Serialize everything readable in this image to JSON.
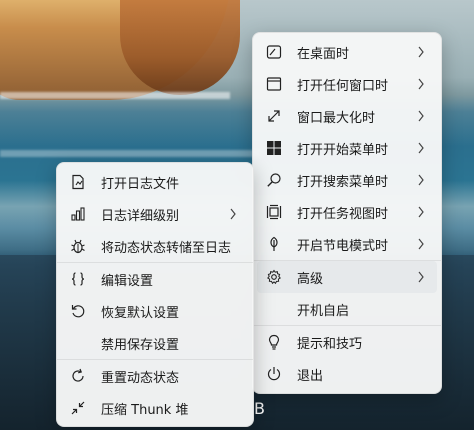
{
  "right_menu": {
    "items": [
      {
        "label": "在桌面时",
        "icon": "desktop-icon",
        "submenu": true
      },
      {
        "label": "打开任何窗口时",
        "icon": "window-icon",
        "submenu": true
      },
      {
        "label": "窗口最大化时",
        "icon": "maximize-icon",
        "submenu": true
      },
      {
        "label": "打开开始菜单时",
        "icon": "windows-logo-icon",
        "submenu": true
      },
      {
        "label": "打开搜索菜单时",
        "icon": "search-icon",
        "submenu": true
      },
      {
        "label": "打开任务视图时",
        "icon": "task-view-icon",
        "submenu": true
      },
      {
        "label": "开启节电模式时",
        "icon": "leaf-icon",
        "submenu": true
      },
      {
        "label": "高级",
        "icon": "gear-icon",
        "submenu": true
      },
      {
        "label": "开机自启",
        "icon": "",
        "submenu": false
      },
      {
        "label": "提示和技巧",
        "icon": "lightbulb-icon",
        "submenu": false
      },
      {
        "label": "退出",
        "icon": "power-icon",
        "submenu": false
      }
    ]
  },
  "left_menu": {
    "items": [
      {
        "label": "打开日志文件",
        "icon": "log-file-icon",
        "submenu": false
      },
      {
        "label": "日志详细级别",
        "icon": "bar-chart-icon",
        "submenu": true
      },
      {
        "label": "将动态状态转储至日志",
        "icon": "bug-icon",
        "submenu": false
      },
      {
        "label": "编辑设置",
        "icon": "braces-icon",
        "submenu": false
      },
      {
        "label": "恢复默认设置",
        "icon": "undo-icon",
        "submenu": false
      },
      {
        "label": "禁用保存设置",
        "icon": "",
        "submenu": false
      },
      {
        "label": "重置动态状态",
        "icon": "refresh-icon",
        "submenu": false
      },
      {
        "label": "压缩 Thunk 堆",
        "icon": "compress-icon",
        "submenu": false
      }
    ]
  },
  "taskbar": {
    "glyph": "B"
  },
  "colors": {
    "menu_bg": "#f6f7f7",
    "highlight": "#e6e9eb",
    "text": "#1a1a1a"
  }
}
